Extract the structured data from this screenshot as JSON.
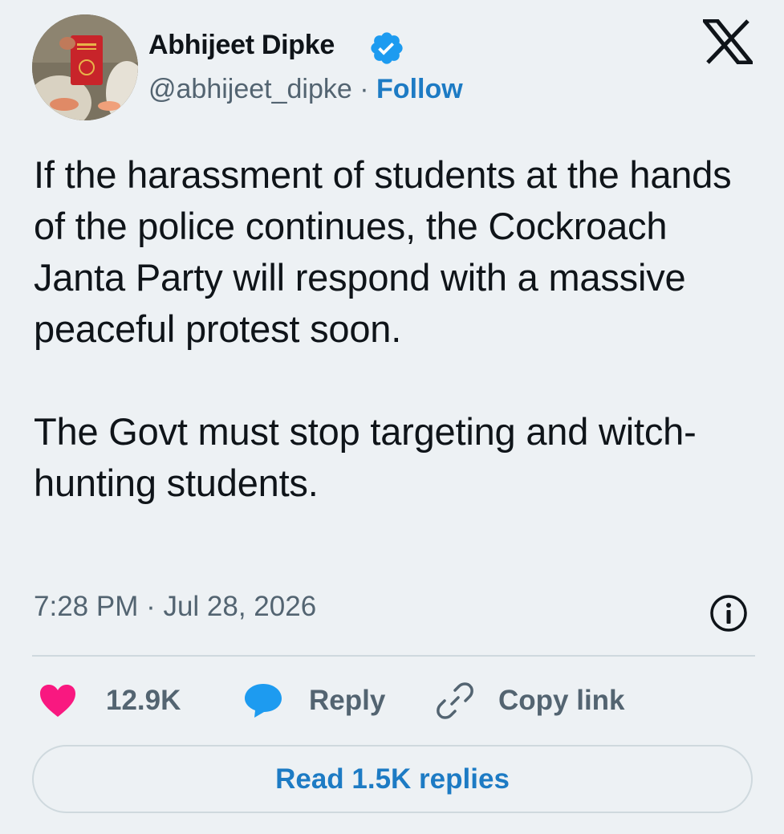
{
  "author": {
    "display_name": "Abhijeet Dipke",
    "handle": "@abhijeet_dipke",
    "separator": " · ",
    "follow_label": "Follow",
    "verified": true
  },
  "tweet": {
    "text": "If the harassment of students at the hands of the police continues, the Cockroach Janta Party will respond with a massive peaceful protest soon.\n\nThe Govt must stop targeting and witch-hunting students.",
    "timestamp": "7:28 PM · Jul 28, 2026"
  },
  "actions": {
    "like_count": "12.9K",
    "reply_label": "Reply",
    "copy_link_label": "Copy link"
  },
  "read_replies_label": "Read 1.5K replies",
  "icons": {
    "avatar": "profile-photo",
    "verified": "verified-badge-icon",
    "brand": "x-logo-icon",
    "info": "info-icon",
    "like": "heart-icon",
    "reply": "speech-bubble-icon",
    "copy": "link-icon"
  },
  "colors": {
    "background": "#edf1f4",
    "text": "#0f1419",
    "secondary_text": "#536471",
    "accent": "#1d7bc4",
    "like": "#f91880",
    "reply_icon": "#1d9bf0",
    "verified": "#1d9bf0",
    "border": "#cfd9de"
  }
}
